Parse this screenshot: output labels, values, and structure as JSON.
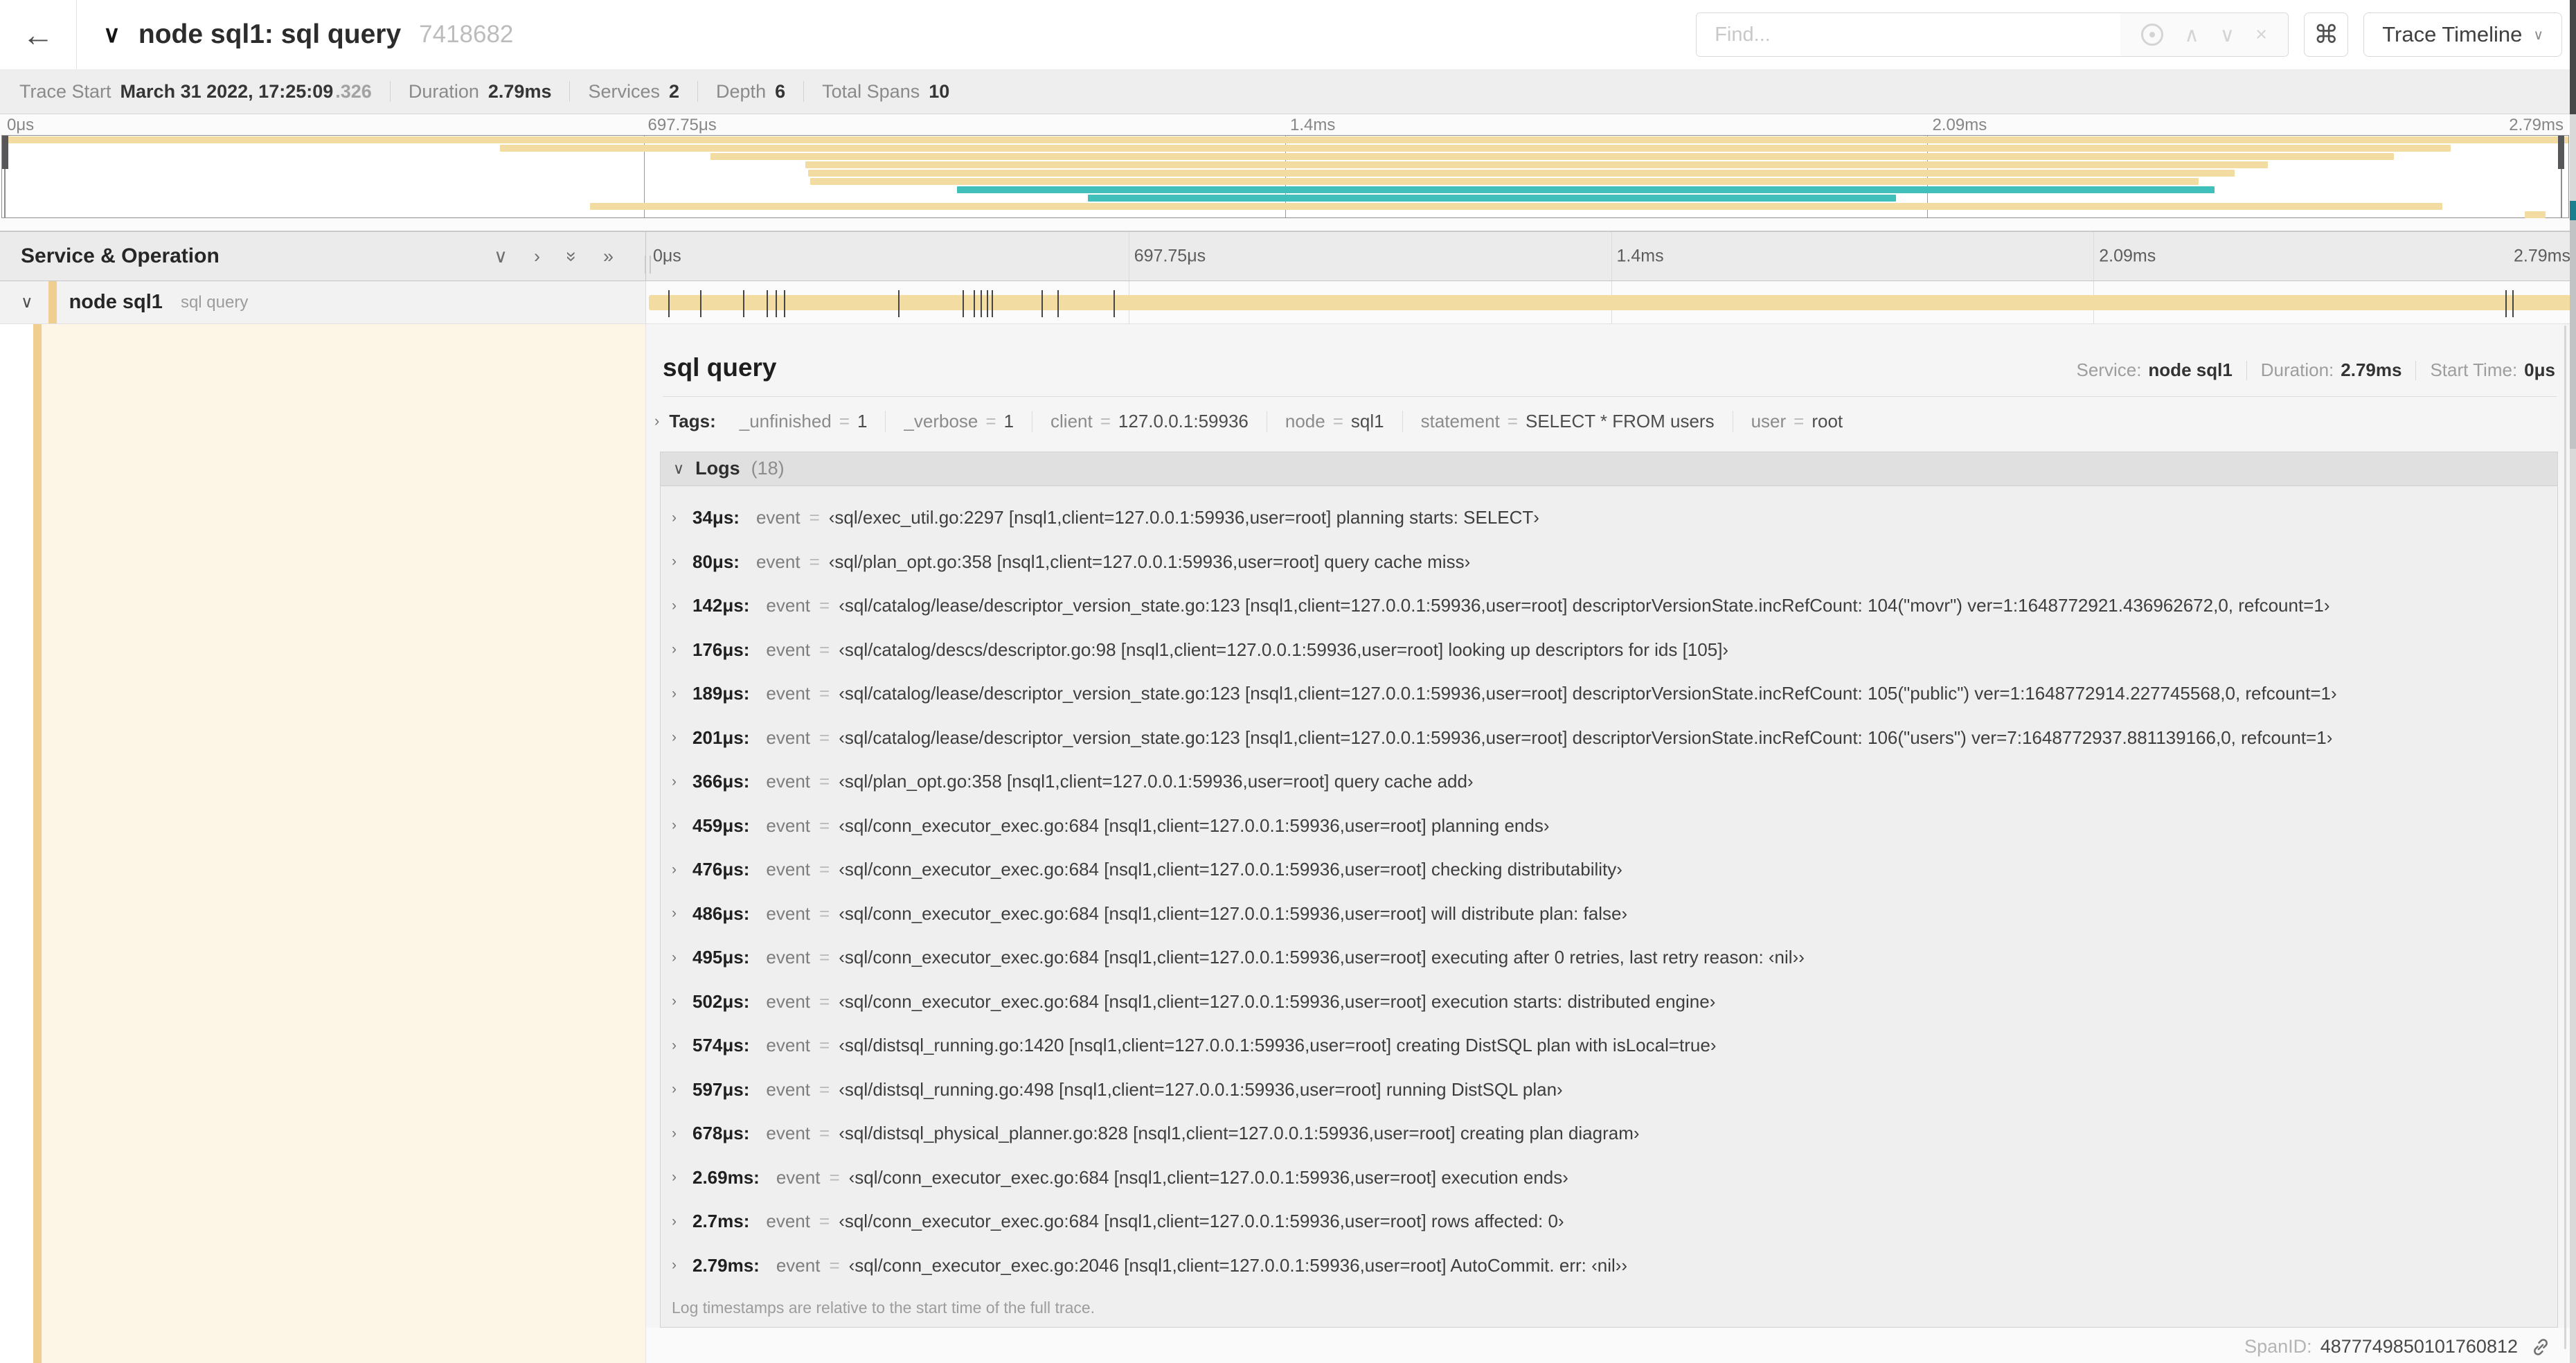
{
  "colors": {
    "tan": "#f3dca2",
    "teal": "#41c0bb",
    "accent": "#efce90",
    "cream": "#fdf6e7"
  },
  "header": {
    "back_icon": "←",
    "collapse_icon": "∨",
    "title": "node sql1: sql query",
    "trace_id": "7418682",
    "find": {
      "placeholder": "Find..."
    },
    "find_icons": {
      "prev": "∧",
      "next": "∨",
      "clear": "×"
    },
    "shortcut_button": "⌘",
    "view_button": {
      "label": "Trace Timeline",
      "chevron": "∨"
    }
  },
  "trace_info": {
    "items": [
      {
        "label": "Trace Start",
        "value": "March 31 2022, 17:25:09",
        "sub": ".326"
      },
      {
        "label": "Duration",
        "value": "2.79ms"
      },
      {
        "label": "Services",
        "value": "2"
      },
      {
        "label": "Depth",
        "value": "6"
      },
      {
        "label": "Total Spans",
        "value": "10"
      }
    ]
  },
  "timeline": {
    "duration_us": 2790,
    "ticks": [
      "0μs",
      "697.75μs",
      "1.4ms",
      "2.09ms",
      "2.79ms"
    ],
    "header_title": "Service & Operation",
    "header_icons": {
      "collapse_one": "∨",
      "expand_one": "›",
      "collapse_all": "»",
      "expand_all": "»"
    },
    "minimap_rows": [
      {
        "s": 0.0,
        "e": 100.0,
        "c": "tan"
      },
      {
        "s": 19.4,
        "e": 95.4,
        "c": "tan"
      },
      {
        "s": 27.6,
        "e": 93.2,
        "c": "tan"
      },
      {
        "s": 31.3,
        "e": 88.3,
        "c": "tan"
      },
      {
        "s": 31.4,
        "e": 87.0,
        "c": "tan"
      },
      {
        "s": 31.5,
        "e": 85.6,
        "c": "tan"
      },
      {
        "s": 37.2,
        "e": 86.2,
        "c": "teal"
      },
      {
        "s": 42.3,
        "e": 73.8,
        "c": "teal"
      },
      {
        "s": 22.9,
        "e": 95.1,
        "c": "tan"
      },
      {
        "s": 98.3,
        "e": 99.1,
        "c": "tan"
      }
    ]
  },
  "span_row": {
    "collapse_icon": "∨",
    "service": "node sql1",
    "operation": "sql query"
  },
  "detail": {
    "title": "sql query",
    "summary": [
      {
        "label": "Service:",
        "value": "node sql1"
      },
      {
        "label": "Duration:",
        "value": "2.79ms"
      },
      {
        "label": "Start Time:",
        "value": "0μs"
      }
    ],
    "tags_chevron": "›",
    "tags_label": "Tags:",
    "tags": [
      {
        "k": "_unfinished",
        "v": "1"
      },
      {
        "k": "_verbose",
        "v": "1"
      },
      {
        "k": "client",
        "v": "127.0.0.1:59936"
      },
      {
        "k": "node",
        "v": "sql1"
      },
      {
        "k": "statement",
        "v": "SELECT * FROM users"
      },
      {
        "k": "user",
        "v": "root"
      }
    ],
    "logs_chevron": "∨",
    "logs_label": "Logs",
    "logs_count": "(18)",
    "logs": [
      {
        "t": "34μs:",
        "us": 34,
        "field": "event",
        "msg": "‹sql/exec_util.go:2297 [nsql1,client=127.0.0.1:59936,user=root] planning starts: SELECT›"
      },
      {
        "t": "80μs:",
        "us": 80,
        "field": "event",
        "msg": "‹sql/plan_opt.go:358 [nsql1,client=127.0.0.1:59936,user=root] query cache miss›"
      },
      {
        "t": "142μs:",
        "us": 142,
        "field": "event",
        "msg": "‹sql/catalog/lease/descriptor_version_state.go:123 [nsql1,client=127.0.0.1:59936,user=root] descriptorVersionState.incRefCount: 104(\"movr\") ver=1:1648772921.436962672,0, refcount=1›"
      },
      {
        "t": "176μs:",
        "us": 176,
        "field": "event",
        "msg": "‹sql/catalog/descs/descriptor.go:98 [nsql1,client=127.0.0.1:59936,user=root] looking up descriptors for ids [105]›"
      },
      {
        "t": "189μs:",
        "us": 189,
        "field": "event",
        "msg": "‹sql/catalog/lease/descriptor_version_state.go:123 [nsql1,client=127.0.0.1:59936,user=root] descriptorVersionState.incRefCount: 105(\"public\") ver=1:1648772914.227745568,0, refcount=1›"
      },
      {
        "t": "201μs:",
        "us": 201,
        "field": "event",
        "msg": "‹sql/catalog/lease/descriptor_version_state.go:123 [nsql1,client=127.0.0.1:59936,user=root] descriptorVersionState.incRefCount: 106(\"users\") ver=7:1648772937.881139166,0, refcount=1›"
      },
      {
        "t": "366μs:",
        "us": 366,
        "field": "event",
        "msg": "‹sql/plan_opt.go:358 [nsql1,client=127.0.0.1:59936,user=root] query cache add›"
      },
      {
        "t": "459μs:",
        "us": 459,
        "field": "event",
        "msg": "‹sql/conn_executor_exec.go:684 [nsql1,client=127.0.0.1:59936,user=root] planning ends›"
      },
      {
        "t": "476μs:",
        "us": 476,
        "field": "event",
        "msg": "‹sql/conn_executor_exec.go:684 [nsql1,client=127.0.0.1:59936,user=root] checking distributability›"
      },
      {
        "t": "486μs:",
        "us": 486,
        "field": "event",
        "msg": "‹sql/conn_executor_exec.go:684 [nsql1,client=127.0.0.1:59936,user=root] will distribute plan: false›"
      },
      {
        "t": "495μs:",
        "us": 495,
        "field": "event",
        "msg": "‹sql/conn_executor_exec.go:684 [nsql1,client=127.0.0.1:59936,user=root] executing after 0 retries, last retry reason: ‹nil››"
      },
      {
        "t": "502μs:",
        "us": 502,
        "field": "event",
        "msg": "‹sql/conn_executor_exec.go:684 [nsql1,client=127.0.0.1:59936,user=root] execution starts: distributed engine›"
      },
      {
        "t": "574μs:",
        "us": 574,
        "field": "event",
        "msg": "‹sql/distsql_running.go:1420 [nsql1,client=127.0.0.1:59936,user=root] creating DistSQL plan with isLocal=true›"
      },
      {
        "t": "597μs:",
        "us": 597,
        "field": "event",
        "msg": "‹sql/distsql_running.go:498 [nsql1,client=127.0.0.1:59936,user=root] running DistSQL plan›"
      },
      {
        "t": "678μs:",
        "us": 678,
        "field": "event",
        "msg": "‹sql/distsql_physical_planner.go:828 [nsql1,client=127.0.0.1:59936,user=root] creating plan diagram›"
      },
      {
        "t": "2.69ms:",
        "us": 2690,
        "field": "event",
        "msg": "‹sql/conn_executor_exec.go:684 [nsql1,client=127.0.0.1:59936,user=root] execution ends›"
      },
      {
        "t": "2.7ms:",
        "us": 2700,
        "field": "event",
        "msg": "‹sql/conn_executor_exec.go:684 [nsql1,client=127.0.0.1:59936,user=root] rows affected: 0›"
      },
      {
        "t": "2.79ms:",
        "us": 2790,
        "field": "event",
        "msg": "‹sql/conn_executor_exec.go:2046 [nsql1,client=127.0.0.1:59936,user=root] AutoCommit. err: ‹nil››"
      }
    ],
    "logs_note": "Log timestamps are relative to the start time of the full trace.",
    "span_id_label": "SpanID:",
    "span_id": "4877749850101760812"
  }
}
